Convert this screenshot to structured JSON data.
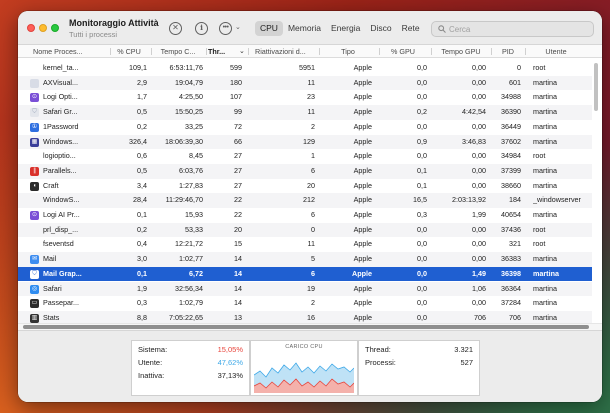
{
  "window": {
    "title": "Monitoraggio Attività",
    "subtitle": "Tutti i processi"
  },
  "toolbar": {
    "stop_icon": "xmark-circle-icon",
    "info_icon": "info-circle-icon",
    "more_icon": "ellipsis-circle-icon",
    "tabs": [
      {
        "label": "CPU",
        "active": true
      },
      {
        "label": "Memoria",
        "active": false
      },
      {
        "label": "Energia",
        "active": false
      },
      {
        "label": "Disco",
        "active": false
      },
      {
        "label": "Rete",
        "active": false
      }
    ],
    "search_placeholder": "Cerca"
  },
  "columns": [
    "Nome Proces...",
    "% CPU",
    "Tempo C...",
    "Thr...",
    "Riattivazioni d...",
    "Tipo",
    "% GPU",
    "Tempo GPU",
    "PID",
    "Utente"
  ],
  "rows": [
    {
      "name": "kernel_ta...",
      "cpu": "109,1",
      "time": "6:53:11,76",
      "threads": "599",
      "wakeups": "5951",
      "type": "Apple",
      "gpu": "0,0",
      "gputime": "0,00",
      "pid": "0",
      "user": "root",
      "icon": "none",
      "icon_color": "#ffffff"
    },
    {
      "name": "AXVisual...",
      "cpu": "2,9",
      "time": "19:04,79",
      "threads": "180",
      "wakeups": "11",
      "type": "Apple",
      "gpu": "0,0",
      "gputime": "0,00",
      "pid": "601",
      "user": "martina",
      "icon": "generic-app-icon",
      "icon_color": "#d8dce6"
    },
    {
      "name": "Logi Opti...",
      "cpu": "1,7",
      "time": "4:25,50",
      "threads": "107",
      "wakeups": "23",
      "type": "Apple",
      "gpu": "0,0",
      "gputime": "0,00",
      "pid": "34988",
      "user": "martina",
      "icon": "logi-options-icon",
      "icon_color": "#7a4fd6"
    },
    {
      "name": "Safari Gr...",
      "cpu": "0,5",
      "time": "15:50,25",
      "threads": "99",
      "wakeups": "11",
      "type": "Apple",
      "gpu": "0,2",
      "gputime": "4:42,54",
      "pid": "36390",
      "user": "martina",
      "icon": "shield-icon",
      "icon_color": "#e3e6ec"
    },
    {
      "name": "1Password",
      "cpu": "0,2",
      "time": "33,25",
      "threads": "72",
      "wakeups": "2",
      "type": "Apple",
      "gpu": "0,0",
      "gputime": "0,00",
      "pid": "36449",
      "user": "martina",
      "icon": "1password-icon",
      "icon_color": "#2f6fe0"
    },
    {
      "name": "Windows...",
      "cpu": "326,4",
      "time": "18:06:39,30",
      "threads": "66",
      "wakeups": "129",
      "type": "Apple",
      "gpu": "0,9",
      "gputime": "3:46,83",
      "pid": "37602",
      "user": "martina",
      "icon": "windows-vm-icon",
      "icon_color": "#3b3f9a"
    },
    {
      "name": "logioptio...",
      "cpu": "0,6",
      "time": "8,45",
      "threads": "27",
      "wakeups": "1",
      "type": "Apple",
      "gpu": "0,0",
      "gputime": "0,00",
      "pid": "34984",
      "user": "root",
      "icon": "none",
      "icon_color": "#ffffff"
    },
    {
      "name": "Parallels...",
      "cpu": "0,5",
      "time": "6:03,76",
      "threads": "27",
      "wakeups": "6",
      "type": "Apple",
      "gpu": "0,1",
      "gputime": "0,00",
      "pid": "37399",
      "user": "martina",
      "icon": "parallels-icon",
      "icon_color": "#d9312b"
    },
    {
      "name": "Craft",
      "cpu": "3,4",
      "time": "1:27,83",
      "threads": "27",
      "wakeups": "20",
      "type": "Apple",
      "gpu": "0,1",
      "gputime": "0,00",
      "pid": "38660",
      "user": "martina",
      "icon": "craft-icon",
      "icon_color": "#2a2a2a"
    },
    {
      "name": "WindowS...",
      "cpu": "28,4",
      "time": "11:29:46,70",
      "threads": "22",
      "wakeups": "212",
      "type": "Apple",
      "gpu": "16,5",
      "gputime": "2:03:13,92",
      "pid": "184",
      "user": "_windowserver",
      "icon": "none",
      "icon_color": "#ffffff"
    },
    {
      "name": "Logi AI Pr...",
      "cpu": "0,1",
      "time": "15,93",
      "threads": "22",
      "wakeups": "6",
      "type": "Apple",
      "gpu": "0,3",
      "gputime": "1,99",
      "pid": "40654",
      "user": "martina",
      "icon": "logi-ai-icon",
      "icon_color": "#7a4fd6"
    },
    {
      "name": "prl_disp_...",
      "cpu": "0,2",
      "time": "53,33",
      "threads": "20",
      "wakeups": "0",
      "type": "Apple",
      "gpu": "0,0",
      "gputime": "0,00",
      "pid": "37436",
      "user": "root",
      "icon": "none",
      "icon_color": "#ffffff"
    },
    {
      "name": "fseventsd",
      "cpu": "0,4",
      "time": "12:21,72",
      "threads": "15",
      "wakeups": "11",
      "type": "Apple",
      "gpu": "0,0",
      "gputime": "0,00",
      "pid": "321",
      "user": "root",
      "icon": "none",
      "icon_color": "#ffffff"
    },
    {
      "name": "Mail",
      "cpu": "3,0",
      "time": "1:02,77",
      "threads": "14",
      "wakeups": "5",
      "type": "Apple",
      "gpu": "0,0",
      "gputime": "0,00",
      "pid": "36383",
      "user": "martina",
      "icon": "mail-icon",
      "icon_color": "#3c8cf0"
    },
    {
      "name": "Mail Grap...",
      "cpu": "0,1",
      "time": "6,72",
      "threads": "14",
      "wakeups": "6",
      "type": "Apple",
      "gpu": "0,0",
      "gputime": "1,49",
      "pid": "36398",
      "user": "martina",
      "icon": "shield-icon",
      "icon_color": "#ffffff",
      "selected": true
    },
    {
      "name": "Safari",
      "cpu": "1,9",
      "time": "32:56,34",
      "threads": "14",
      "wakeups": "19",
      "type": "Apple",
      "gpu": "0,0",
      "gputime": "1,06",
      "pid": "36364",
      "user": "martina",
      "icon": "safari-icon",
      "icon_color": "#2f8cf0"
    },
    {
      "name": "Passepar...",
      "cpu": "0,3",
      "time": "1:02,79",
      "threads": "14",
      "wakeups": "2",
      "type": "Apple",
      "gpu": "0,0",
      "gputime": "0,00",
      "pid": "37284",
      "user": "martina",
      "icon": "passepartout-icon",
      "icon_color": "#2b2b2b"
    },
    {
      "name": "Stats",
      "cpu": "8,8",
      "time": "7:05:22,65",
      "threads": "13",
      "wakeups": "16",
      "type": "Apple",
      "gpu": "0,0",
      "gputime": "706",
      "pid": "706",
      "user": "martina",
      "icon": "stats-icon",
      "icon_color": "#333333"
    }
  ],
  "footer": {
    "sistema_label": "Sistema:",
    "sistema_value": "15,05%",
    "utente_label": "Utente:",
    "utente_value": "47,62%",
    "inattiva_label": "Inattiva:",
    "inattiva_value": "37,13%",
    "chart_title": "CARICO CPU",
    "thread_label": "Thread:",
    "thread_value": "3.321",
    "processi_label": "Processi:",
    "processi_value": "527",
    "colors": {
      "system": "#e8453c",
      "user": "#3fa9e8"
    }
  }
}
